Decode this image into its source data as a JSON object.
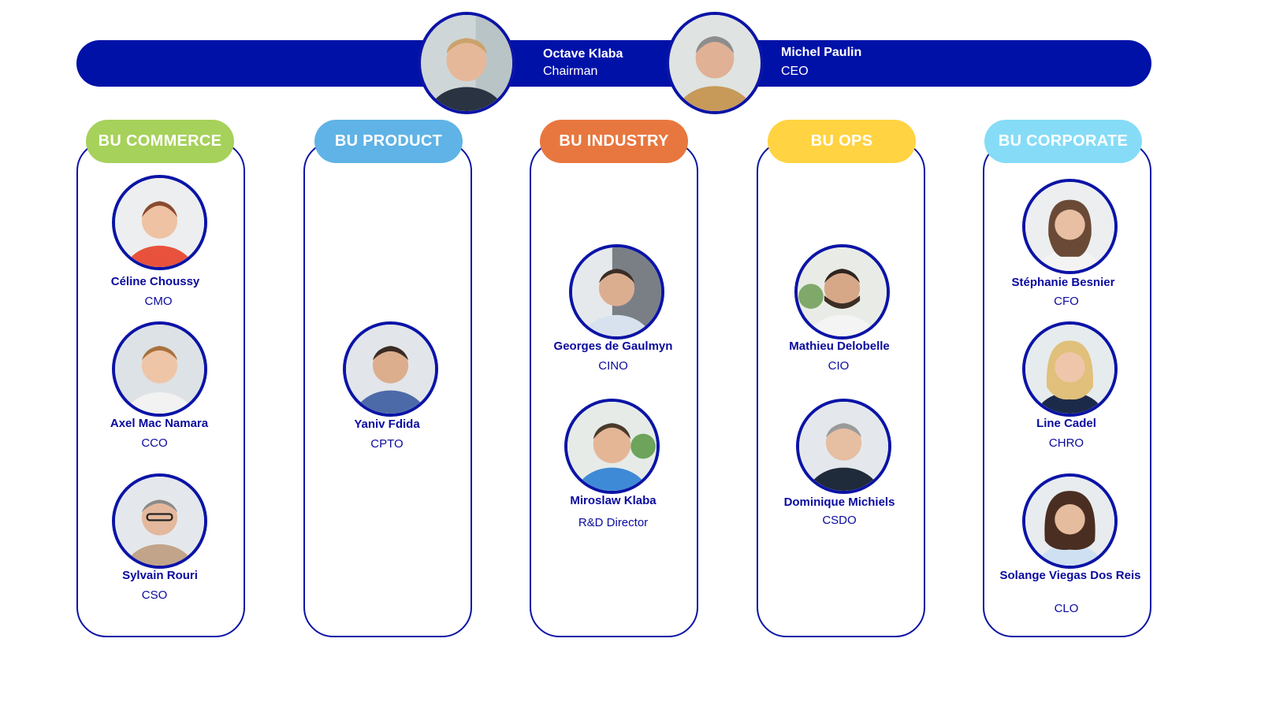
{
  "executives": [
    {
      "name": "Octave Klaba",
      "role": "Chairman"
    },
    {
      "name": "Michel Paulin",
      "role": "CEO"
    }
  ],
  "business_units": [
    {
      "label": "BU COMMERCE",
      "color": "#a6d15a",
      "people": [
        {
          "name": "Céline Choussy",
          "role": "CMO"
        },
        {
          "name": "Axel Mac Namara",
          "role": "CCO"
        },
        {
          "name": "Sylvain Rouri",
          "role": "CSO"
        }
      ]
    },
    {
      "label": "BU PRODUCT",
      "color": "#5fb3e6",
      "people": [
        {
          "name": "Yaniv Fdida",
          "role": "CPTO"
        }
      ]
    },
    {
      "label": "BU INDUSTRY",
      "color": "#e8773f",
      "people": [
        {
          "name": "Georges de Gaulmyn",
          "role": "CINO"
        },
        {
          "name": "Miroslaw Klaba",
          "role": "R&D Director"
        }
      ]
    },
    {
      "label": "BU OPS",
      "color": "#ffd342",
      "people": [
        {
          "name": "Mathieu Delobelle",
          "role": "CIO"
        },
        {
          "name": "Dominique Michiels",
          "role": "CSDO"
        }
      ]
    },
    {
      "label": "BU CORPORATE",
      "color": "#86dcf6",
      "people": [
        {
          "name": "Stéphanie Besnier",
          "role": "CFO"
        },
        {
          "name": "Line Cadel",
          "role": "CHRO"
        },
        {
          "name": "Solange Viegas Dos Reis",
          "role": "CLO"
        }
      ]
    }
  ],
  "colors": {
    "primary": "#0011a8",
    "border": "#0b14a6"
  },
  "icons": {
    "photo": "person-photo-icon"
  }
}
